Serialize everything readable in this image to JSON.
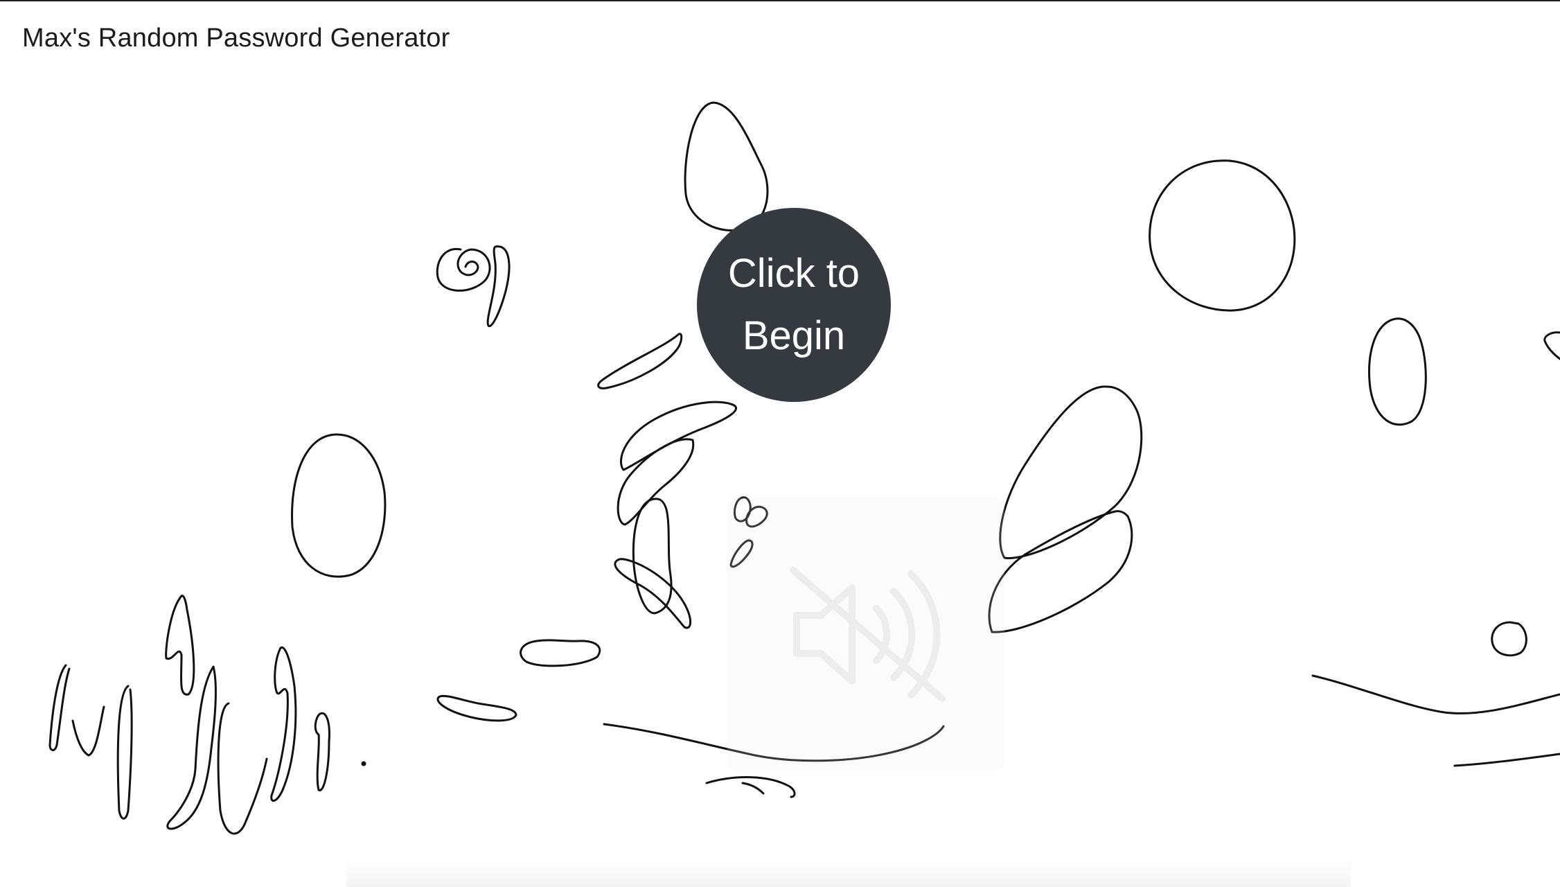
{
  "app": {
    "title": "Max's Random Password Generator"
  },
  "start_button": {
    "label": "Click to Begin",
    "background": "#343a40",
    "text_color": "#ffffff"
  },
  "mute_indicator": {
    "icon": "speaker-muted-icon"
  }
}
